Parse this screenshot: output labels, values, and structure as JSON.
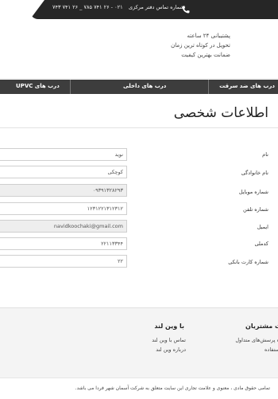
{
  "topbar": {
    "phone_label": "شماره تماس دفتر مرکزی",
    "phone_numbers": "۰۲۱ - ۲۶ ۷۴۱ ۷۸۵ _ ۲۶ ۷۴۱ ۷۴۳",
    "icon": "phone-icon"
  },
  "header": {
    "features": [
      "پشتیبانی ۲۴ ساعته",
      "تحویل در کوتاه ترین زمان",
      "ضمانت بهترین کیفیت"
    ]
  },
  "nav": {
    "items": [
      "درب های ضد سرقت",
      "درب های داخلی",
      "درب های UPVC"
    ]
  },
  "main": {
    "title": "اطلاعات شخصی",
    "fields": [
      {
        "label": "نام",
        "value": "نوید"
      },
      {
        "label": "نام خانوادگی",
        "value": "کوچکی"
      },
      {
        "label": "شماره موبایل",
        "value": "۰۹۳۹۱۳۲۸۲۹۳"
      },
      {
        "label": "شماره تلفن",
        "value": "۱۲۳۱۲۲۱۳۱۲۳۱۲"
      },
      {
        "label": "ایمیل",
        "value": "navidkoochaki@gmail.com"
      },
      {
        "label": "کدملی",
        "value": "۲۲۱۱۳۳۴۴"
      },
      {
        "label": "شماره کارت بانکی",
        "value": "۲۲"
      }
    ]
  },
  "footer": {
    "col1_title": "با وین لند",
    "col1_links": [
      "تماس با وین لند",
      "درباره وین لند"
    ],
    "col2_title": "ت مشتریان",
    "col2_links": [
      "ه پرسش‌های متداول",
      "ستفاده"
    ],
    "copyright": "تمامی حقوق مادی ، معنوی و علامت تجاری این سایت متعلق به شرکت آسمان شهر فردا می باشد."
  }
}
